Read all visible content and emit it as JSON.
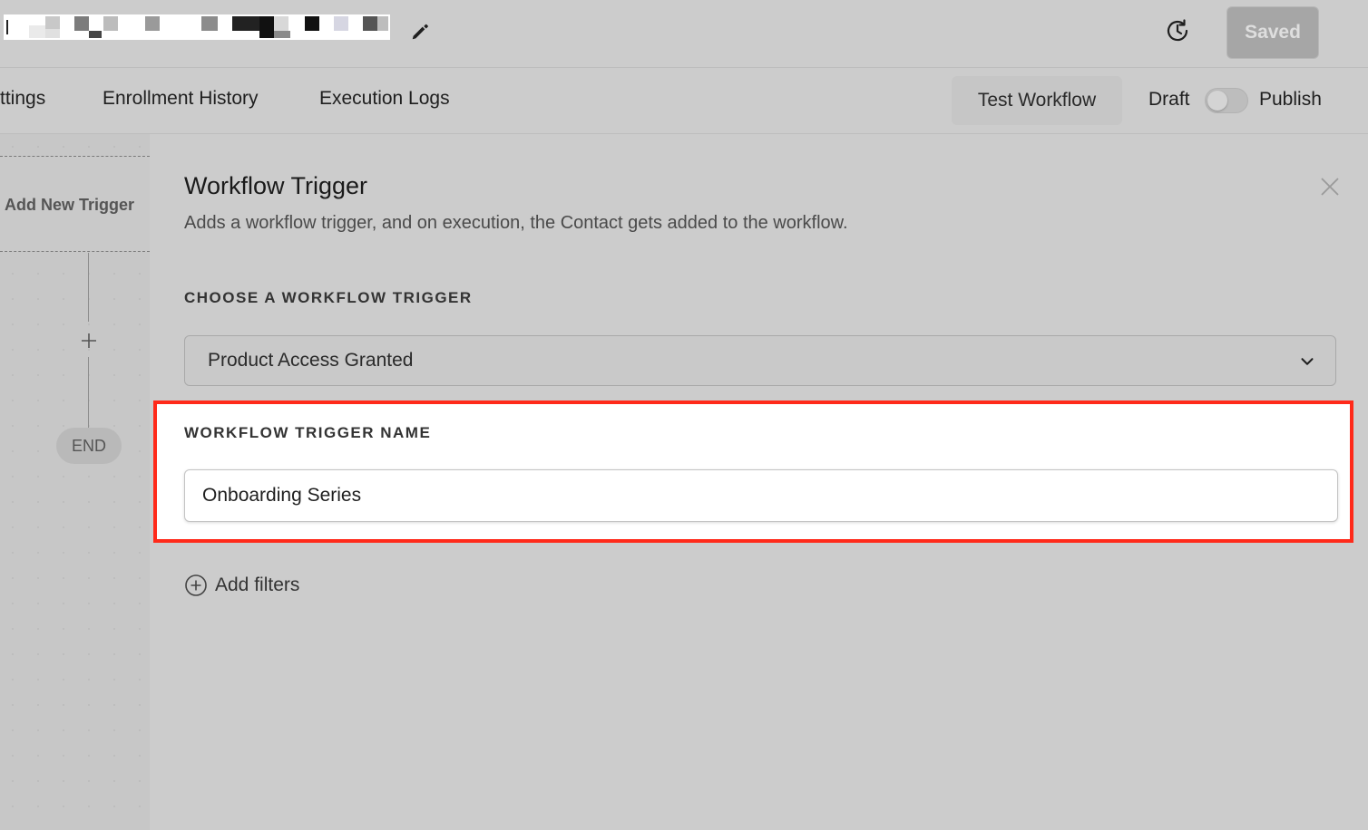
{
  "header": {
    "saved_label": "Saved"
  },
  "tabs": [
    {
      "label": "ttings"
    },
    {
      "label": "Enrollment History"
    },
    {
      "label": "Execution Logs"
    }
  ],
  "toolbar": {
    "test_workflow_label": "Test Workflow",
    "draft_label": "Draft",
    "publish_label": "Publish",
    "publish_toggle_on": false
  },
  "canvas": {
    "trigger_label": "Add New Trigger",
    "end_label": "END"
  },
  "panel": {
    "title": "Workflow Trigger",
    "description": "Adds a workflow trigger, and on execution, the Contact gets added to the workflow.",
    "choose_label": "CHOOSE A WORKFLOW TRIGGER",
    "selected_trigger": "Product Access Granted",
    "name_label": "WORKFLOW TRIGGER NAME",
    "name_value": "Onboarding Series",
    "add_filters_label": "Add filters"
  },
  "colors": {
    "highlight": "#ff2a1a",
    "background": "#cccccc"
  }
}
